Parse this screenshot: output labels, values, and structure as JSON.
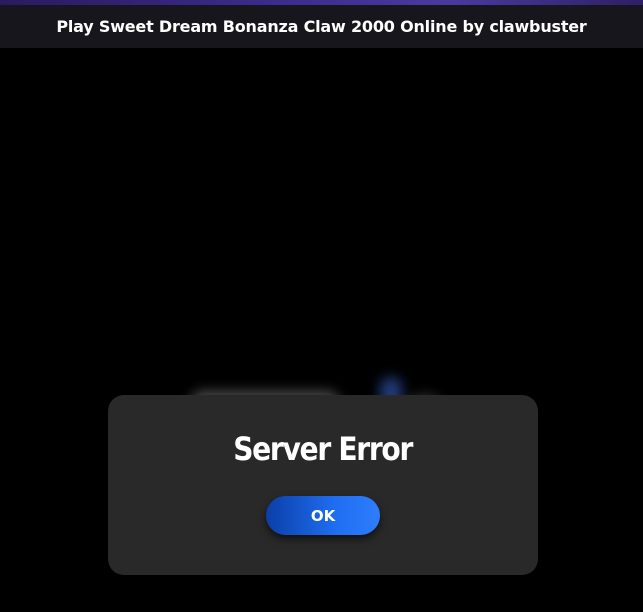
{
  "header": {
    "title": "Play Sweet Dream Bonanza Claw 2000 Online by clawbuster"
  },
  "dialog": {
    "title": "Server Error",
    "ok_label": "OK"
  },
  "colors": {
    "accent_bar": "#3b2a8a",
    "header_bg": "#17161c",
    "dialog_bg": "#292929",
    "button_blue": "#1f6df0"
  }
}
